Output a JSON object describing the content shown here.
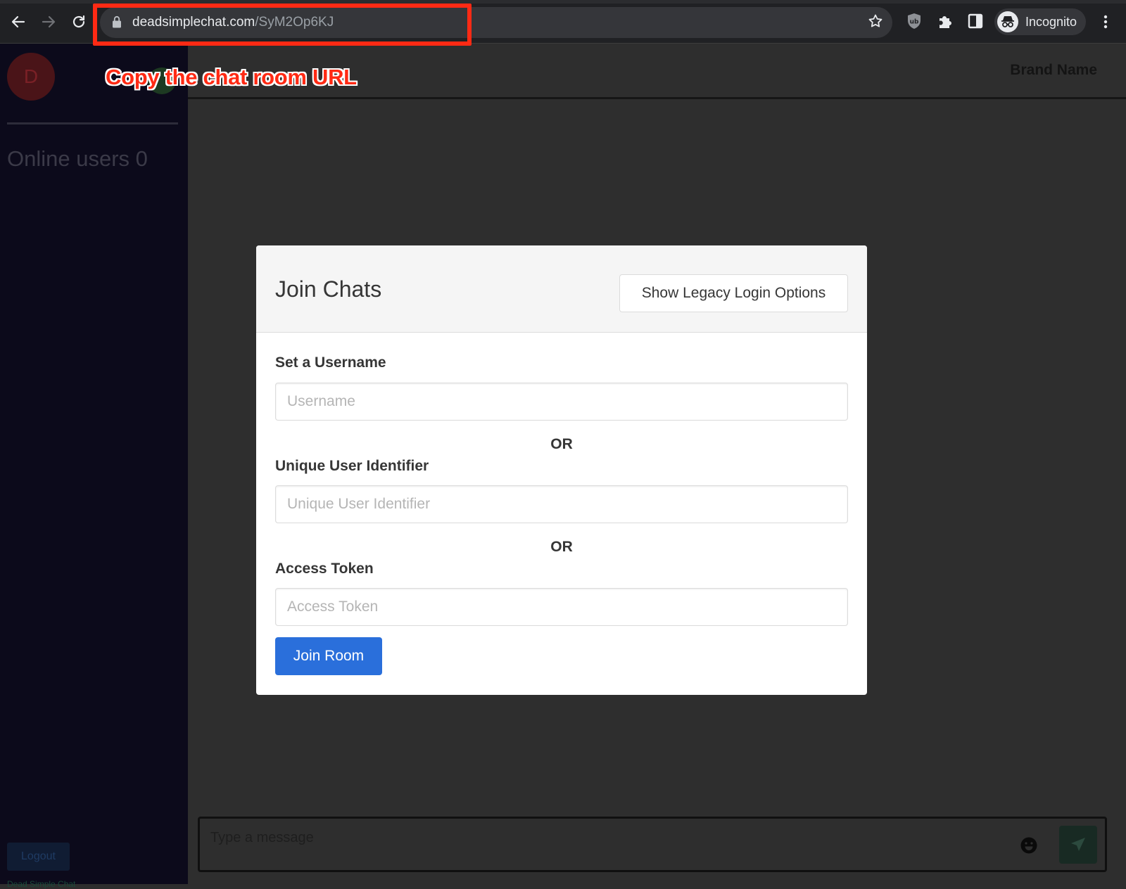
{
  "browser": {
    "url_host": "deadsimplechat.com",
    "url_path": "/SyM2Op6KJ",
    "profile_label": "Incognito"
  },
  "annotation": {
    "text": "Copy the chat room URL",
    "color": "#ff2a14"
  },
  "sidebar": {
    "avatar_initial": "D",
    "online_users": "Online users 0",
    "logout_label": "Logout",
    "footer_text": "Dead Simple Chat"
  },
  "topbar": {
    "brand": "Brand Name"
  },
  "composer": {
    "placeholder": "Type a message"
  },
  "modal": {
    "title": "Join Chats",
    "legacy_button": "Show Legacy Login Options",
    "username_label": "Set a Username",
    "username_placeholder": "Username",
    "or_text": "OR",
    "uid_label": "Unique User Identifier",
    "uid_placeholder": "Unique User Identifier",
    "token_label": "Access Token",
    "token_placeholder": "Access Token",
    "join_button": "Join Room",
    "primary_color": "#2a6fdb"
  }
}
